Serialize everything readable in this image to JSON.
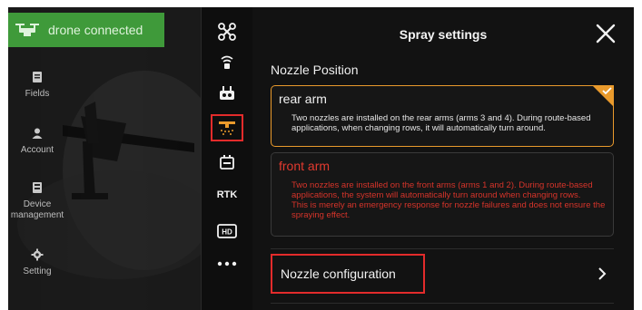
{
  "status_banner": {
    "text": "drone connected",
    "icon": "drone-icon",
    "color": "#3f9a3a"
  },
  "sidebar": {
    "items": [
      {
        "label": "Fields",
        "icon": "fields-icon"
      },
      {
        "label": "Account",
        "icon": "account-icon"
      },
      {
        "label": "Device\nmanagement",
        "icon": "device-icon"
      },
      {
        "label": "Setting",
        "icon": "gear-icon"
      }
    ]
  },
  "toolbar": {
    "items": [
      {
        "icon": "drone-icon"
      },
      {
        "icon": "radar-icon"
      },
      {
        "icon": "remote-controller-icon"
      },
      {
        "icon": "spray-nozzle-icon",
        "active": true
      },
      {
        "icon": "battery-icon"
      },
      {
        "icon": "rtk-icon",
        "label": "RTK"
      },
      {
        "icon": "hd-icon",
        "label": "HD"
      },
      {
        "icon": "more-icon"
      }
    ],
    "active_border_color": "#e32b2b"
  },
  "settings": {
    "title": "Spray settings",
    "close_icon": "close-icon",
    "section_title": "Nozzle Position",
    "options": [
      {
        "title": "rear arm",
        "selected": true,
        "accent": "#e99a2c",
        "description": "Two nozzles are installed on the rear arms (arms 3 and 4). During route-based applications, when changing rows, it will automatically turn around."
      },
      {
        "title": "front arm",
        "selected": false,
        "accent": "#e23a2f",
        "description": "Two nozzles are installed on the front arms (arms 1 and 2). During route-based applications, the system will automatically turn around when changing rows.",
        "warning": "This is merely an emergency response for nozzle failures and does not ensure the spraying effect."
      }
    ],
    "nozzle_configuration": {
      "label": "Nozzle configuration",
      "arrow_icon": "chevron-right-icon"
    }
  }
}
